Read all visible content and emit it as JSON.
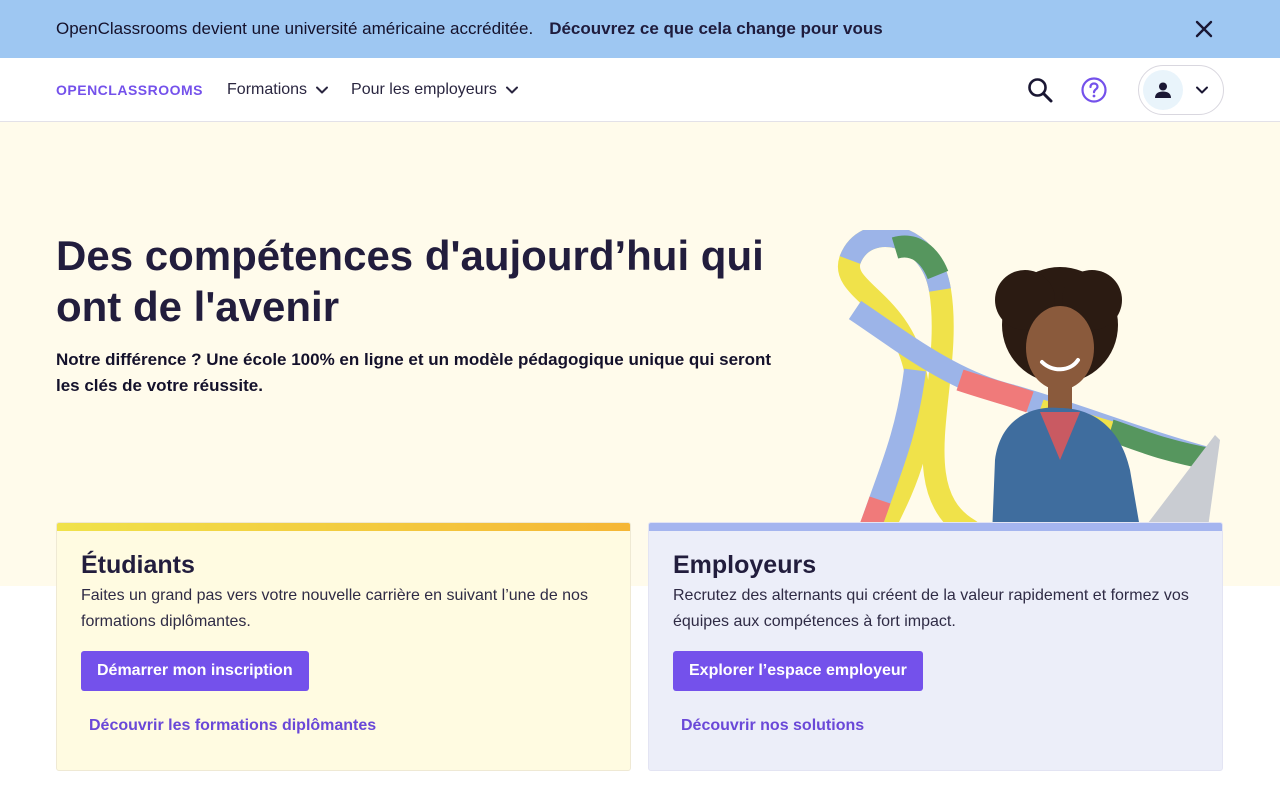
{
  "banner": {
    "text": "OpenClassrooms devient une université américaine accréditée.",
    "link": "Découvrez ce que cela change pour vous",
    "close_icon": "close-icon"
  },
  "header": {
    "logo": "OPENCLASSROOMS",
    "nav": [
      {
        "label": "Formations",
        "icon": "chevron-down-icon"
      },
      {
        "label": "Pour les employeurs",
        "icon": "chevron-down-icon"
      }
    ],
    "icons": {
      "search": "search-icon",
      "help": "help-icon",
      "account": "user-icon"
    }
  },
  "hero": {
    "title": "Des compétences d'aujourd’hui qui ont de l'avenir",
    "subtitle": "Notre différence ? Une école 100% en ligne et un modèle pédagogique unique qui seront les clés de votre réussite."
  },
  "cards": {
    "students": {
      "title": "Étudiants",
      "text": "Faites un grand pas vers votre nouvelle carrière en suivant l’une de nos formations diplômantes.",
      "button": "Démarrer mon inscription",
      "link": "Découvrir les formations diplômantes"
    },
    "employers": {
      "title": "Employeurs",
      "text": "Recrutez des alternants qui créent de la valeur rapidement et formez vos équipes aux compétences à fort impact.",
      "button": "Explorer l’espace employeur",
      "link": "Découvrir nos solutions"
    }
  },
  "colors": {
    "banner": "#9ec7f2",
    "accent": "#7451eb",
    "hero_bg": "#fffbeb",
    "students_card": "#fffbe1",
    "employers_card": "#eceef9"
  }
}
